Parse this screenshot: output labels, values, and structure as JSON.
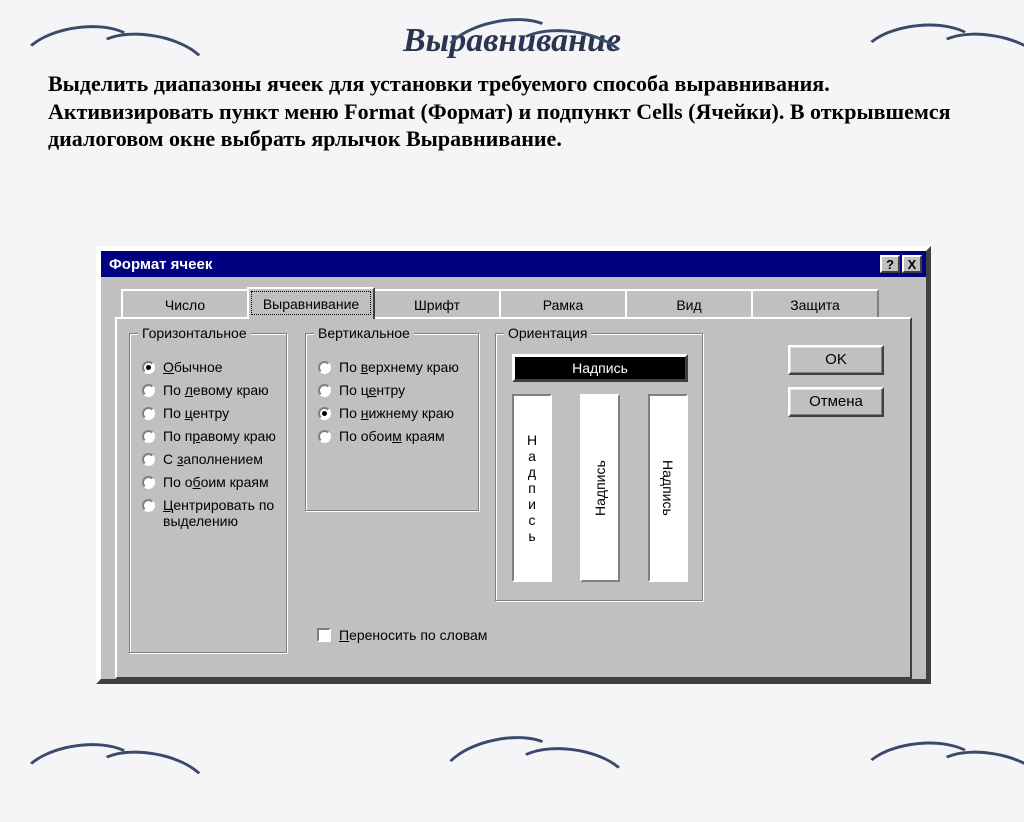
{
  "page": {
    "title": "Выравнивание",
    "intro": "Выделить диапазоны ячеек для установки требуемого способа выравнивания. Активизировать пункт меню Format (Формат) и подпункт Cells (Ячейки). В открывшемся диалоговом окне выбрать ярлычок Выравнивание."
  },
  "dialog": {
    "title": "Формат ячеек",
    "help_glyph": "?",
    "close_glyph": "X",
    "tabs": {
      "number": "Число",
      "align": "Выравнивание",
      "font": "Шрифт",
      "border": "Рамка",
      "view": "Вид",
      "protect": "Защита"
    },
    "buttons": {
      "ok": "OK",
      "cancel": "Отмена"
    },
    "groups": {
      "horizontal": {
        "legend": "Горизонтальное",
        "options": [
          "Обычное",
          "По левому краю",
          "По центру",
          "По правому краю",
          "С заполнением",
          "По обоим краям",
          "Центрировать по выделению"
        ],
        "selected_index": 0
      },
      "vertical": {
        "legend": "Вертикальное",
        "options": [
          "По верхнему краю",
          "По центру",
          "По нижнему краю",
          "По обоим краям"
        ],
        "selected_index": 2
      },
      "orientation": {
        "legend": "Ориентация",
        "sample_label": "Надпись",
        "col1": "Надпись",
        "col2": "Надпись",
        "col3": "Надпись"
      }
    },
    "wrap_label": "Переносить по словам"
  }
}
